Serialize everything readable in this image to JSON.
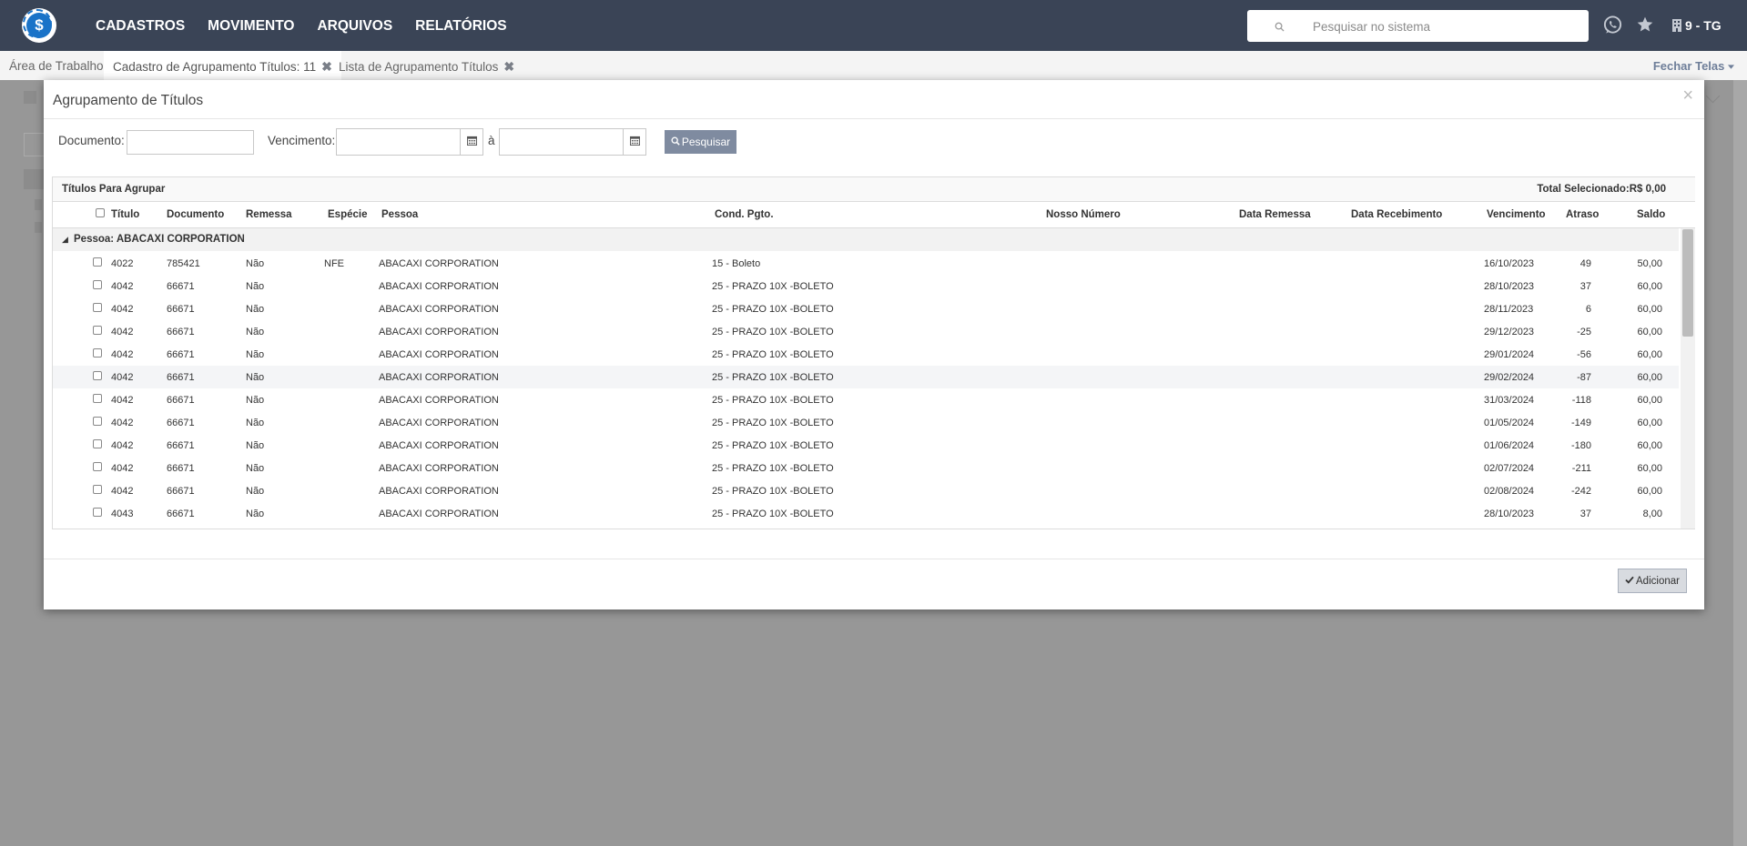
{
  "topbar": {
    "logo_symbol": "$",
    "nav": [
      "CADASTROS",
      "MOVIMENTO",
      "ARQUIVOS",
      "RELATÓRIOS"
    ],
    "search_placeholder": "Pesquisar no sistema",
    "company": "9 - TG",
    "icons": [
      "search-icon",
      "whatsapp-icon",
      "star-icon",
      "building-icon"
    ]
  },
  "tabs": [
    {
      "label": "Área de Trabalho",
      "closable": false,
      "active": false
    },
    {
      "label": "Cadastro de Agrupamento Títulos: 11",
      "closable": true,
      "active": true
    },
    {
      "label": "Lista de Agrupamento Títulos",
      "closable": true,
      "active": false
    }
  ],
  "close_screens": "Fechar Telas",
  "close_symbol": "✖",
  "modal": {
    "title": "Agrupamento de Títulos",
    "close": "×",
    "filters": {
      "documento_label": "Documento:",
      "documento_value": "",
      "vencimento_label": "Vencimento:",
      "vencimento_from": "",
      "separator": "à",
      "vencimento_to": "",
      "search_button": "Pesquisar"
    },
    "grid": {
      "title": "Títulos Para Agrupar",
      "total": "Total Selecionado:R$ 0,00",
      "columns": {
        "titulo": "Título",
        "documento": "Documento",
        "remessa": "Remessa",
        "especie": "Espécie",
        "pessoa": "Pessoa",
        "cond": "Cond. Pgto.",
        "nosso_numero": "Nosso Número",
        "data_remessa": "Data Remessa",
        "data_recebimento": "Data Recebimento",
        "vencimento": "Vencimento",
        "atraso": "Atraso",
        "saldo": "Saldo"
      },
      "group_label": "Pessoa: ABACAXI CORPORATION",
      "rows": [
        {
          "titulo": "4022",
          "documento": "785421",
          "remessa": "Não",
          "especie": "NFE",
          "pessoa": "ABACAXI CORPORATION",
          "cond": "15 - Boleto",
          "vencimento": "16/10/2023",
          "atraso": "49",
          "saldo": "50,00"
        },
        {
          "titulo": "4042",
          "documento": "66671",
          "remessa": "Não",
          "especie": "",
          "pessoa": "ABACAXI CORPORATION",
          "cond": "25 - PRAZO 10X -BOLETO",
          "vencimento": "28/10/2023",
          "atraso": "37",
          "saldo": "60,00"
        },
        {
          "titulo": "4042",
          "documento": "66671",
          "remessa": "Não",
          "especie": "",
          "pessoa": "ABACAXI CORPORATION",
          "cond": "25 - PRAZO 10X -BOLETO",
          "vencimento": "28/11/2023",
          "atraso": "6",
          "saldo": "60,00"
        },
        {
          "titulo": "4042",
          "documento": "66671",
          "remessa": "Não",
          "especie": "",
          "pessoa": "ABACAXI CORPORATION",
          "cond": "25 - PRAZO 10X -BOLETO",
          "vencimento": "29/12/2023",
          "atraso": "-25",
          "saldo": "60,00"
        },
        {
          "titulo": "4042",
          "documento": "66671",
          "remessa": "Não",
          "especie": "",
          "pessoa": "ABACAXI CORPORATION",
          "cond": "25 - PRAZO 10X -BOLETO",
          "vencimento": "29/01/2024",
          "atraso": "-56",
          "saldo": "60,00"
        },
        {
          "titulo": "4042",
          "documento": "66671",
          "remessa": "Não",
          "especie": "",
          "pessoa": "ABACAXI CORPORATION",
          "cond": "25 - PRAZO 10X -BOLETO",
          "vencimento": "29/02/2024",
          "atraso": "-87",
          "saldo": "60,00"
        },
        {
          "titulo": "4042",
          "documento": "66671",
          "remessa": "Não",
          "especie": "",
          "pessoa": "ABACAXI CORPORATION",
          "cond": "25 - PRAZO 10X -BOLETO",
          "vencimento": "31/03/2024",
          "atraso": "-118",
          "saldo": "60,00"
        },
        {
          "titulo": "4042",
          "documento": "66671",
          "remessa": "Não",
          "especie": "",
          "pessoa": "ABACAXI CORPORATION",
          "cond": "25 - PRAZO 10X -BOLETO",
          "vencimento": "01/05/2024",
          "atraso": "-149",
          "saldo": "60,00"
        },
        {
          "titulo": "4042",
          "documento": "66671",
          "remessa": "Não",
          "especie": "",
          "pessoa": "ABACAXI CORPORATION",
          "cond": "25 - PRAZO 10X -BOLETO",
          "vencimento": "01/06/2024",
          "atraso": "-180",
          "saldo": "60,00"
        },
        {
          "titulo": "4042",
          "documento": "66671",
          "remessa": "Não",
          "especie": "",
          "pessoa": "ABACAXI CORPORATION",
          "cond": "25 - PRAZO 10X -BOLETO",
          "vencimento": "02/07/2024",
          "atraso": "-211",
          "saldo": "60,00"
        },
        {
          "titulo": "4042",
          "documento": "66671",
          "remessa": "Não",
          "especie": "",
          "pessoa": "ABACAXI CORPORATION",
          "cond": "25 - PRAZO 10X -BOLETO",
          "vencimento": "02/08/2024",
          "atraso": "-242",
          "saldo": "60,00"
        },
        {
          "titulo": "4043",
          "documento": "66671",
          "remessa": "Não",
          "especie": "",
          "pessoa": "ABACAXI CORPORATION",
          "cond": "25 - PRAZO 10X -BOLETO",
          "vencimento": "28/10/2023",
          "atraso": "37",
          "saldo": "8,00"
        }
      ]
    },
    "add_button": "Adicionar"
  },
  "colors": {
    "topbar": "#3a4456",
    "overlay": "#979797",
    "search_button": "#7f8ba0",
    "add_button": "#d8dbe0",
    "accent_link": "#6e7e99"
  }
}
